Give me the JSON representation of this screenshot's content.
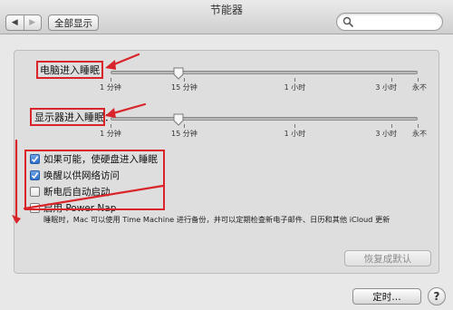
{
  "window": {
    "title": "节能器"
  },
  "toolbar": {
    "back_glyph": "◀",
    "forward_glyph": "▶",
    "show_all_label": "全部显示",
    "search_placeholder": ""
  },
  "sliders": [
    {
      "label": "电脑进入睡眠：",
      "value_fraction": 0.22,
      "ticks": [
        "1 分钟",
        "15 分钟",
        "1 小时",
        "3 小时",
        "永不"
      ]
    },
    {
      "label": "显示器进入睡眠：",
      "value_fraction": 0.22,
      "ticks": [
        "1 分钟",
        "15 分钟",
        "1 小时",
        "3 小时",
        "永不"
      ]
    }
  ],
  "options": [
    {
      "label": "如果可能，使硬盘进入睡眠",
      "checked": true
    },
    {
      "label": "唤醒以供网络访问",
      "checked": true
    },
    {
      "label": "断电后自动启动",
      "checked": false
    },
    {
      "label": "启用 Power Nap",
      "checked": false
    }
  ],
  "note": "睡眠时，Mac 可以使用 Time Machine 进行备份，并可以定期检查新电子邮件、日历和其他 iCloud 更新",
  "buttons": {
    "restore_defaults": "恢复成默认",
    "schedule": "定时…",
    "help": "?"
  },
  "colors": {
    "annotation_red": "#d9252a",
    "checkbox_blue": "#2d6ec9"
  }
}
